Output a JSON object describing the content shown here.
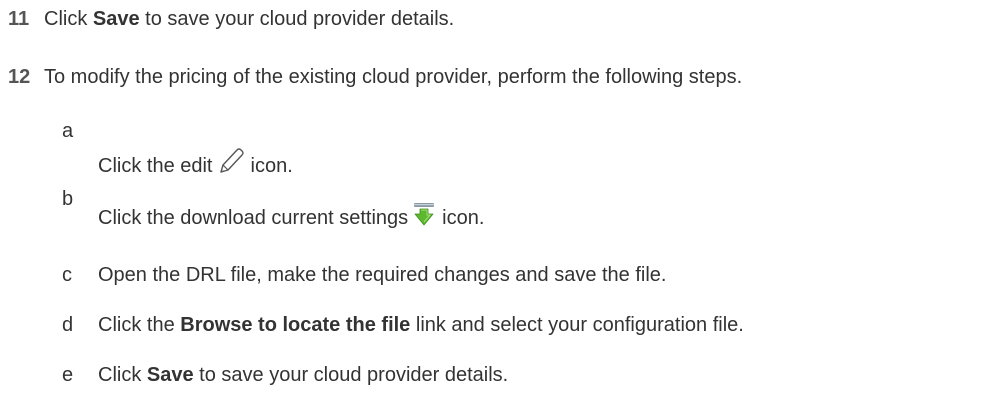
{
  "steps": [
    {
      "number": "11",
      "pre": "Click ",
      "bold": "Save",
      "post": " to save your cloud provider details."
    },
    {
      "number": "12",
      "text": "To modify the pricing of the existing cloud provider, perform the following steps."
    }
  ],
  "substeps": {
    "a": {
      "letter": "a",
      "pre": "Click the edit",
      "post": "icon.",
      "icon": "pencil-icon"
    },
    "b": {
      "letter": "b",
      "pre": "Click the download current settings",
      "post": "icon.",
      "icon": "download-arrow-icon",
      "icon_color": "#5cb82e"
    },
    "c": {
      "letter": "c",
      "text": "Open the DRL file, make the required changes and save the file."
    },
    "d": {
      "letter": "d",
      "pre": "Click the ",
      "bold": "Browse to locate the file",
      "post": " link and select your configuration file."
    },
    "e": {
      "letter": "e",
      "pre": "Click ",
      "bold": "Save",
      "post": " to save your cloud provider details."
    }
  }
}
